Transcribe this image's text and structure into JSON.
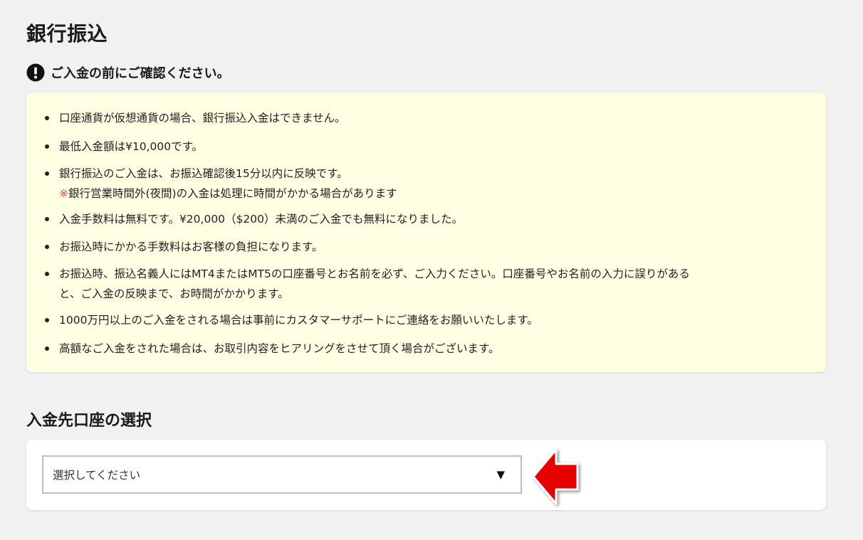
{
  "page_title": "銀行振込",
  "notice": {
    "heading": "ご入金の前にご確認ください。",
    "icon": "exclamation-circle-icon",
    "background_color": "#ffffe3",
    "items": [
      {
        "text": "口座通貨が仮想通貨の場合、銀行振込入金はできません。"
      },
      {
        "text": "最低入金額は¥10,000です。"
      },
      {
        "text": "銀行振込のご入金は、お振込確認後15分以内に反映です。",
        "note_mark": "※",
        "note_text": "銀行営業時間外(夜間)の入金は処理に時間がかかる場合があります"
      },
      {
        "text": "入金手数料は無料です。¥20,000（$200）未満のご入金でも無料になりました。"
      },
      {
        "text": "お振込時にかかる手数料はお客様の負担になります。"
      },
      {
        "text": "お振込時、振込名義人にはMT4またはMT5の口座番号とお名前を必ず、ご入力ください。口座番号やお名前の入力に誤りがある",
        "text2": "と、ご入金の反映まで、お時間がかかります。"
      },
      {
        "text": "1000万円以上のご入金をされる場合は事前にカスタマーサポートにご連絡をお願いいたします。"
      },
      {
        "text": "高額なご入金をされた場合は、お取引内容をヒアリングをさせて頂く場合がございます。"
      }
    ]
  },
  "account_section": {
    "title": "入金先口座の選択",
    "select": {
      "selected_value": "選択してください",
      "caret": "▼"
    }
  },
  "annotation": {
    "icon": "red-arrow-left-icon",
    "color": "#e60000"
  }
}
